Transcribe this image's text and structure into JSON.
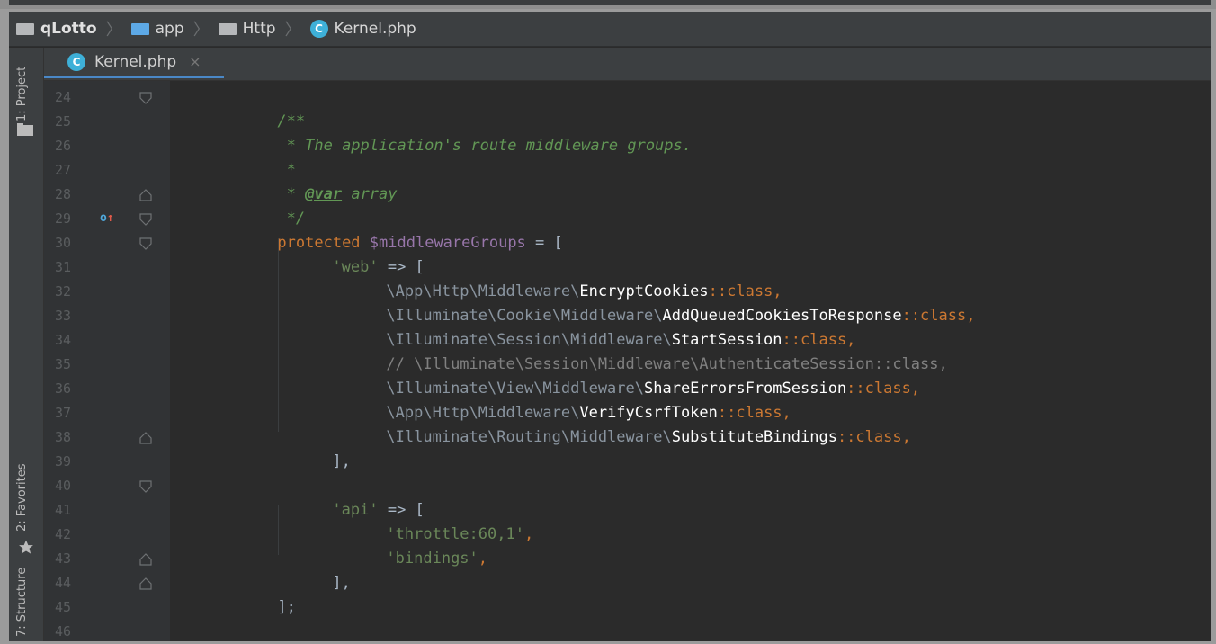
{
  "breadcrumb": {
    "items": [
      "qLotto",
      "app",
      "Http",
      "Kernel.php"
    ]
  },
  "sidebar": {
    "project_label": "1: Project",
    "favorites_label": "2: Favorites",
    "structure_label": "7: Structure"
  },
  "tabs": [
    {
      "label": "Kernel.php",
      "close": "×"
    }
  ],
  "editor": {
    "line_numbers": [
      "24",
      "25",
      "26",
      "27",
      "28",
      "29",
      "30",
      "31",
      "32",
      "33",
      "34",
      "35",
      "36",
      "37",
      "38",
      "39",
      "40",
      "41",
      "42",
      "43",
      "44",
      "45",
      "46"
    ],
    "comment_open": "/**",
    "comment_desc": " * The application's route middleware groups.",
    "comment_star": " *",
    "comment_var_prefix": " * ",
    "comment_var_tag": "@var",
    "comment_var_type": " array",
    "comment_close": " */",
    "decl_keyword": "protected",
    "decl_var": "$middlewareGroups",
    "decl_assign": " = [",
    "web_key": "'web'",
    "api_key": "'api'",
    "arrow": " => [",
    "web_entries": [
      {
        "ns": "\\App\\Http\\Middleware\\",
        "cls": "EncryptCookies",
        "tail": "::class,"
      },
      {
        "ns": "\\Illuminate\\Cookie\\Middleware\\",
        "cls": "AddQueuedCookiesToResponse",
        "tail": "::class,"
      },
      {
        "ns": "\\Illuminate\\Session\\Middleware\\",
        "cls": "StartSession",
        "tail": "::class,"
      },
      {
        "comment": "// \\Illuminate\\Session\\Middleware\\AuthenticateSession::class,"
      },
      {
        "ns": "\\Illuminate\\View\\Middleware\\",
        "cls": "ShareErrorsFromSession",
        "tail": "::class,"
      },
      {
        "ns": "\\App\\Http\\Middleware\\",
        "cls": "VerifyCsrfToken",
        "tail": "::class,"
      },
      {
        "ns": "\\Illuminate\\Routing\\Middleware\\",
        "cls": "SubstituteBindings",
        "tail": "::class,"
      }
    ],
    "close_group": "],",
    "api_entries": [
      "'throttle:60,1'",
      "'bindings'"
    ],
    "close_decl": "];",
    "next_comment": "/**",
    "colors": {
      "background": "#2b2b2b",
      "gutter": "#313335",
      "comment": "#629755",
      "keyword": "#cc7832",
      "variable": "#9876aa",
      "string": "#6a8759"
    }
  }
}
